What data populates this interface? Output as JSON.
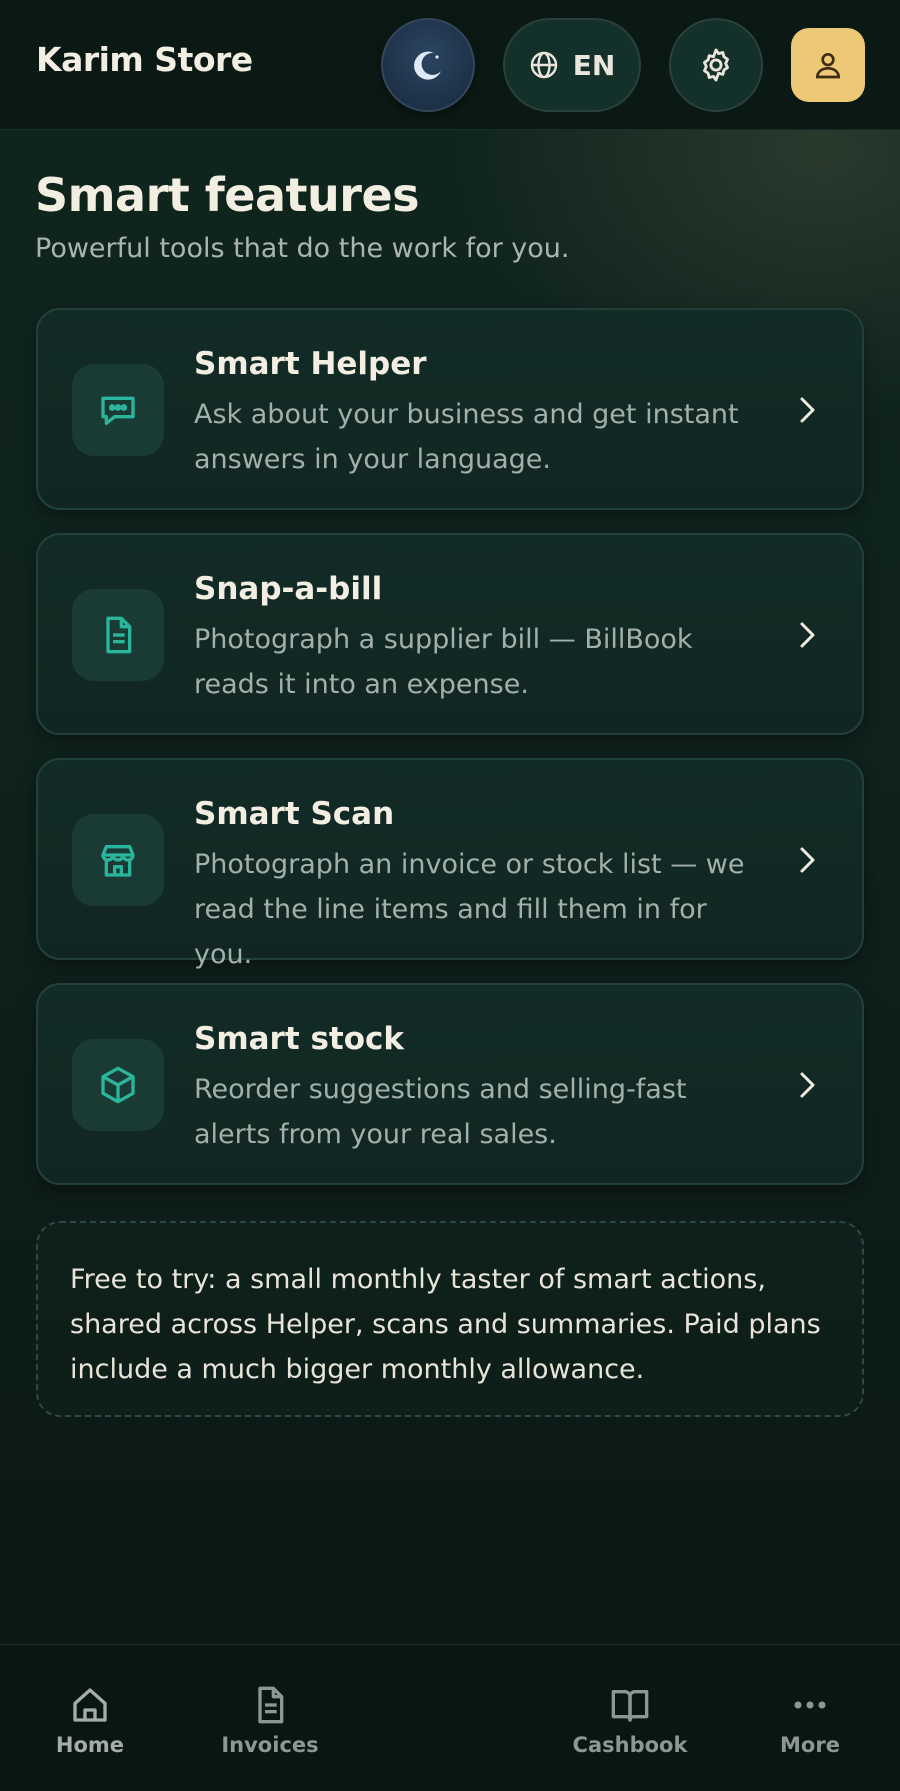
{
  "header": {
    "brand": "Karim Store",
    "language_label": "EN"
  },
  "hero": {
    "title": "Smart features",
    "subtitle": "Powerful tools that do the work for you."
  },
  "features": [
    {
      "title": "Smart Helper",
      "description": "Ask about your business and get instant answers in your language.",
      "icon": "chat-bubble-icon"
    },
    {
      "title": "Snap-a-bill",
      "description": "Photograph a supplier bill — BillBook reads it into an expense.",
      "icon": "document-icon"
    },
    {
      "title": "Smart Scan",
      "description": "Photograph an invoice or stock list — we read the line items and fill them in for you.",
      "icon": "store-icon"
    },
    {
      "title": "Smart stock",
      "description": "Reorder suggestions and selling-fast alerts from your real sales.",
      "icon": "box-icon"
    }
  ],
  "note": {
    "text": "Free to try: a small monthly taster of smart actions, shared across Helper, scans and summaries. Paid plans include a much bigger monthly allowance."
  },
  "nav": {
    "items": [
      {
        "label": "Home",
        "icon": "home-icon"
      },
      {
        "label": "Invoices",
        "icon": "invoice-icon"
      },
      {
        "label": "Cashbook",
        "icon": "book-icon"
      },
      {
        "label": "More",
        "icon": "more-dots-icon"
      }
    ]
  },
  "colors": {
    "accent_teal": "#2bb59c",
    "avatar_gold": "#edc877",
    "background": "#0f221d"
  }
}
